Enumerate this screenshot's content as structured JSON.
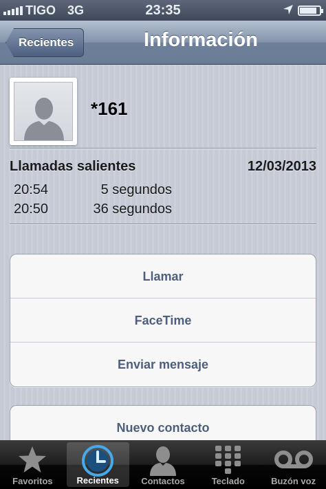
{
  "status_bar": {
    "carrier": "TIGO",
    "network": "3G",
    "time": "23:35",
    "signal_bars": 5,
    "battery_level": 0.85,
    "icons": [
      "signal-icon",
      "location-icon",
      "battery-icon"
    ]
  },
  "nav": {
    "back_label": "Recientes",
    "title": "Información"
  },
  "contact": {
    "name": "*161",
    "avatar_icon": "person-silhouette-icon"
  },
  "calls": {
    "heading": "Llamadas salientes",
    "date": "12/03/2013",
    "items": [
      {
        "time": "20:54",
        "duration": "5 segundos"
      },
      {
        "time": "20:50",
        "duration": "36 segundos"
      }
    ]
  },
  "actions": {
    "call": "Llamar",
    "facetime": "FaceTime",
    "message": "Enviar mensaje",
    "new_contact": "Nuevo contacto"
  },
  "tab_bar": {
    "active": "Recientes",
    "items": [
      {
        "label": "Favoritos",
        "icon": "star-icon"
      },
      {
        "label": "Recientes",
        "icon": "clock-icon"
      },
      {
        "label": "Contactos",
        "icon": "contacts-icon"
      },
      {
        "label": "Teclado",
        "icon": "keypad-icon"
      },
      {
        "label": "Buzón voz",
        "icon": "voicemail-icon"
      }
    ]
  },
  "colors": {
    "nav_bar": "#7385a0",
    "action_text": "#4d5e7e",
    "tab_active": "#ffffff",
    "tab_inactive": "#a8a8a8"
  }
}
